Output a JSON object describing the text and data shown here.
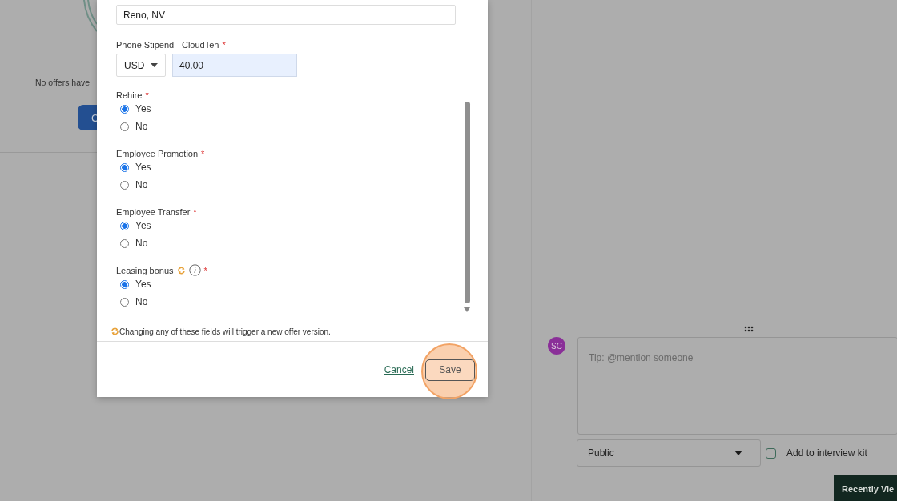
{
  "background": {
    "empty_state_text": "No offers have",
    "create_button": "C"
  },
  "modal": {
    "location_field": {
      "value": "Reno, NV"
    },
    "stipend": {
      "label": "Phone Stipend - CloudTen",
      "required_mark": "*",
      "currency": "USD",
      "amount": "40.00"
    },
    "questions": [
      {
        "label": "Rehire",
        "required_mark": "*",
        "triggers_version": false,
        "info": false,
        "options": [
          {
            "label": "Yes",
            "selected": true
          },
          {
            "label": "No",
            "selected": false
          }
        ]
      },
      {
        "label": "Employee Promotion",
        "required_mark": "*",
        "triggers_version": false,
        "info": false,
        "options": [
          {
            "label": "Yes",
            "selected": true
          },
          {
            "label": "No",
            "selected": false
          }
        ]
      },
      {
        "label": "Employee Transfer",
        "required_mark": "*",
        "triggers_version": false,
        "info": false,
        "options": [
          {
            "label": "Yes",
            "selected": true
          },
          {
            "label": "No",
            "selected": false
          }
        ]
      },
      {
        "label": "Leasing bonus",
        "required_mark": "*",
        "triggers_version": true,
        "info": true,
        "options": [
          {
            "label": "Yes",
            "selected": true
          },
          {
            "label": "No",
            "selected": false
          }
        ]
      }
    ],
    "footnote": "Changing any of these fields will trigger a new offer version.",
    "cancel": "Cancel",
    "save": "Save",
    "save_highlighted": true
  },
  "notes": {
    "avatar": "SC",
    "placeholder": "Tip: @mention someone",
    "visibility": "Public",
    "interview_kit": {
      "label": "Add to interview kit",
      "checked": false
    }
  },
  "recently_viewed": "Recently Vie"
}
